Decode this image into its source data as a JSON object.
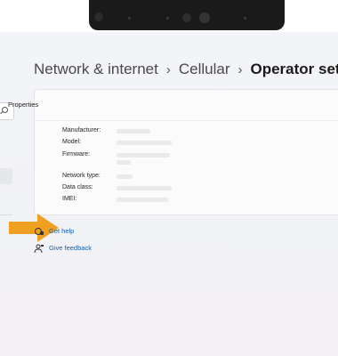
{
  "breadcrumb": {
    "items": [
      "Network & internet",
      "Cellular"
    ],
    "current": "Operator setting"
  },
  "properties": {
    "title": "Properties",
    "rows": [
      {
        "label": "Manufacturer:"
      },
      {
        "label": "Model:"
      },
      {
        "label": "Firmware:"
      },
      {
        "label": "Network type:"
      },
      {
        "label": "Data class:"
      },
      {
        "label": "IMEI:"
      }
    ]
  },
  "links": {
    "help": "Get help",
    "feedback": "Give feedback"
  },
  "colors": {
    "accent_arrow": "#f0a020",
    "link": "#0f5fb0"
  },
  "icons": {
    "search": "search-icon",
    "help": "help-icon",
    "feedback": "feedback-icon",
    "arrow": "arrow-icon"
  }
}
